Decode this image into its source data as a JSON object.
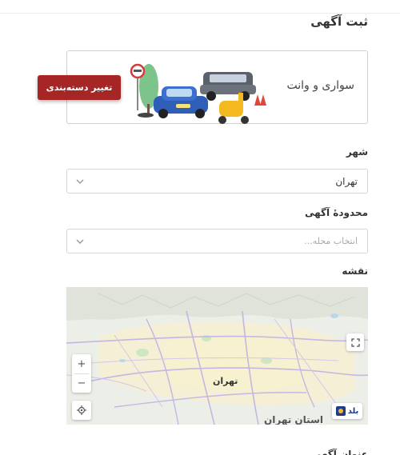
{
  "page": {
    "title": "ثبت آگهی",
    "next_section_label": "عنوان آگهی"
  },
  "category": {
    "name": "سواری و وانت",
    "change_button": "تغییر دسته‌بندی"
  },
  "city": {
    "label": "شهر",
    "value": "تهران"
  },
  "district": {
    "label": "محدودهٔ آگهی",
    "placeholder": "انتخاب محله..."
  },
  "map": {
    "label": "نقشه",
    "city_label": "تهران",
    "province_label": "استان تهران",
    "zoom_in": "+",
    "zoom_out": "−",
    "brand": "بلد"
  },
  "colors": {
    "accent": "#a62626",
    "brand": "#1f3c8a"
  },
  "icons": {
    "chevron": "chevron-down-icon",
    "locate": "crosshair-icon",
    "fullscreen": "expand-icon"
  }
}
